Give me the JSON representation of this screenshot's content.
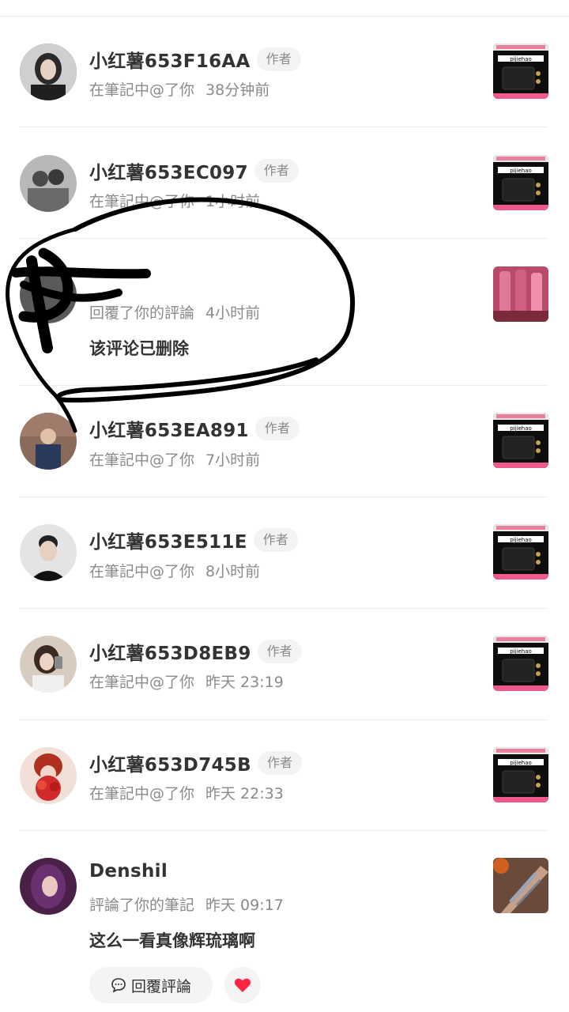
{
  "notifications": [
    {
      "name": "小红薯653F16AA",
      "badge": "作者",
      "action": "在筆記中@了你",
      "time": "38分钟前",
      "avatar_color": "#3a3a3a",
      "thumb": "bag"
    },
    {
      "name": "小红薯653EC097",
      "badge": "作者",
      "action": "在筆記中@了你",
      "time": "1小时前",
      "avatar_color": "#8c8c8c",
      "thumb": "bag"
    },
    {
      "name": "",
      "badge": "",
      "action": "回覆了你的評論",
      "time": "4小时前",
      "comment": "该评论已删除",
      "avatar_color": "#555555",
      "thumb": "pink"
    },
    {
      "name": "小红薯653EA891",
      "badge": "作者",
      "action": "在筆記中@了你",
      "time": "7小时前",
      "avatar_color": "#7a5a4a",
      "thumb": "bag"
    },
    {
      "name": "小红薯653E511E",
      "badge": "作者",
      "action": "在筆記中@了你",
      "time": "8小时前",
      "avatar_color": "#d0d0d0",
      "thumb": "bag"
    },
    {
      "name": "小红薯653D8EB9",
      "badge": "作者",
      "action": "在筆記中@了你",
      "time": "昨天 23:19",
      "avatar_color": "#c9b8a8",
      "thumb": "bag"
    },
    {
      "name": "小红薯653D745B",
      "badge": "作者",
      "action": "在筆記中@了你",
      "time": "昨天 22:33",
      "avatar_color": "#c0392b",
      "thumb": "bag"
    },
    {
      "name": "Denshil",
      "badge": "",
      "action": "評論了你的筆記",
      "time": "昨天 09:17",
      "comment": "这么一看真像辉琉璃啊",
      "avatar_color": "#5a2a5a",
      "thumb": "swatch"
    }
  ],
  "actions": {
    "reply_label": "回覆評論"
  },
  "thumb_text": "pijiehao",
  "colors": {
    "like": "#ff2442",
    "text": "#333333",
    "muted": "#8a8a8a"
  }
}
